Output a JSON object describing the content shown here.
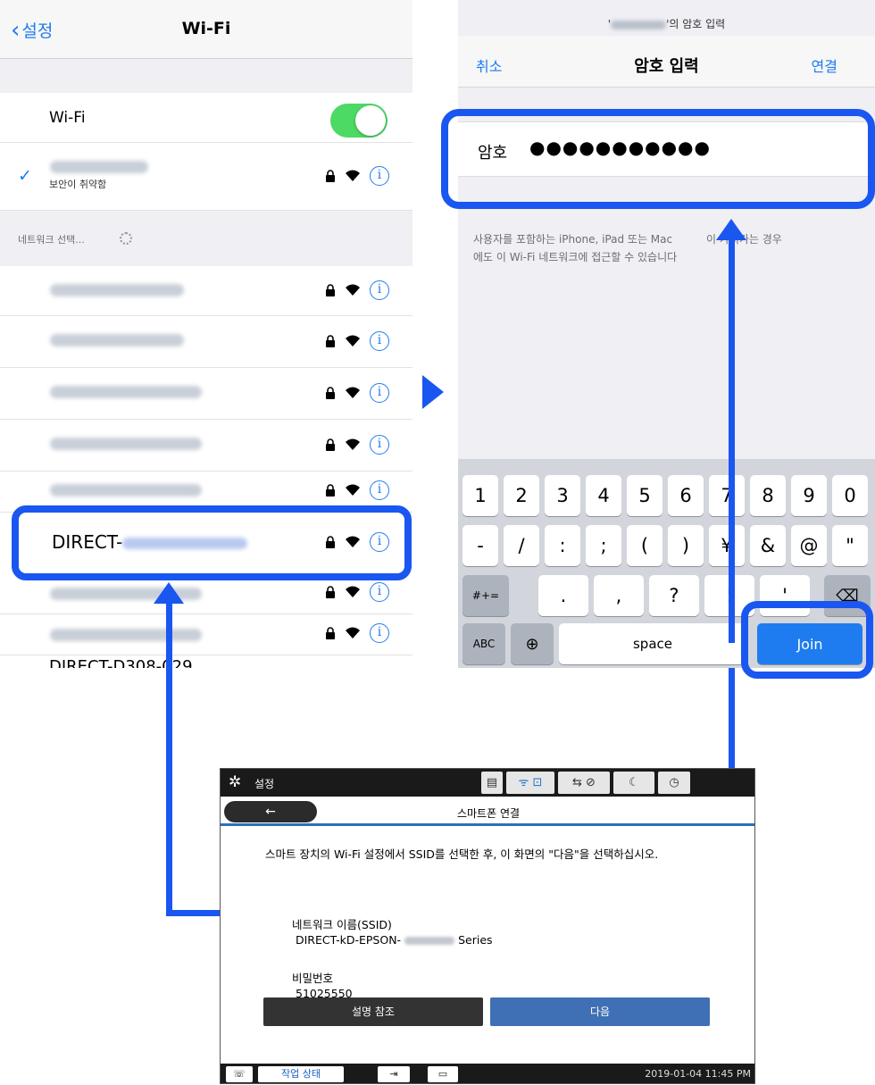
{
  "wifi_screen": {
    "back_label": "설정",
    "title": "Wi-Fi",
    "wifi_toggle_label": "Wi-Fi",
    "connected_status": "보안이 취약함",
    "section_label": "네트워크 선택...",
    "highlighted_network_prefix": "DIRECT-",
    "partial_network": "DIRECT-D308-029"
  },
  "password_screen": {
    "prompt_suffix": "'의 암호 입력",
    "cancel_label": "취소",
    "title": "암호 입력",
    "join_label": "연결",
    "field_label": "암호",
    "password_dots": "●●●●●●●●●●●",
    "hint_line1": "사용자를 포함하는 iPhone, iPad 또는 Mac",
    "hint_line1_end": "이 가져가는 경우",
    "hint_line2": "에도 이 Wi-Fi 네트워크에 접근할 수 있습니다"
  },
  "keyboard": {
    "row1": [
      "1",
      "2",
      "3",
      "4",
      "5",
      "6",
      "7",
      "8",
      "9",
      "0"
    ],
    "row2": [
      "-",
      "/",
      ":",
      ";",
      "(",
      ")",
      "¥",
      "&",
      "@",
      "\""
    ],
    "row3_left": "#+=",
    "row3": [
      ".",
      ",",
      "?",
      "!",
      "'"
    ],
    "abc": "ABC",
    "space": "space",
    "join": "Join"
  },
  "printer_panel": {
    "top_title": "설정",
    "back_arrow": "←",
    "screen_title": "스마트폰 연결",
    "instruction": "스마트 장치의 Wi-Fi 설정에서 SSID를 선택한 후, 이 화면의 \"다음\"을 선택하십시오.",
    "network_name_label": "네트워크 이름(SSID)",
    "ssid_prefix": "DIRECT-kD-EPSON-",
    "ssid_suffix": "Series",
    "password_label": "비밀번호",
    "password_value": "51025550",
    "help_button": "설명 참조",
    "next_button": "다음",
    "job_status_button": "작업 상태",
    "datetime": "2019-01-04 11:45 PM"
  },
  "colors": {
    "ios_blue": "#1e7cf0",
    "annotation_blue": "#1a56f0",
    "toggle_green": "#4cd964",
    "printer_dark": "#1a1a1a",
    "printer_accent": "#2e6fb8"
  }
}
